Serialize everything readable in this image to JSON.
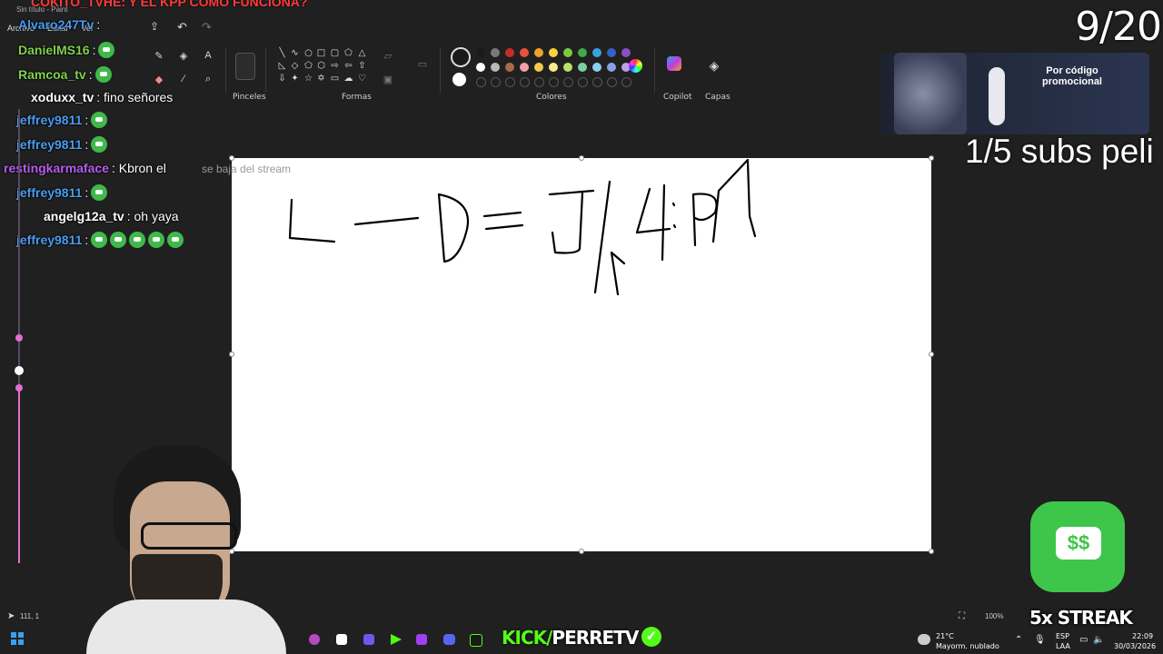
{
  "window": {
    "title": "Sin título - Paint",
    "menu": [
      "Archivo",
      "Editar",
      "Ver"
    ]
  },
  "ribbon": {
    "groups": {
      "brushes": "Pinceles",
      "shapes": "Formas",
      "colors": "Colores",
      "copilot": "Copilot",
      "layers": "Capas"
    },
    "colors_row1": [
      "#1a1a1a",
      "#7a7a7a",
      "#c42b2b",
      "#e5533b",
      "#f0a030",
      "#f6d53a",
      "#7ec83e",
      "#3ea84a",
      "#3aa0e0",
      "#3561c8",
      "#8d4fc0"
    ],
    "colors_row2": [
      "#ffffff",
      "#b8b8b8",
      "#a86a4a",
      "#f0a0a8",
      "#f6c84a",
      "#f6ec8a",
      "#b8e06a",
      "#7ad0a0",
      "#8ad0f0",
      "#8aa0e0",
      "#c0a0e0"
    ],
    "primary_color": "#1a1a1a",
    "secondary_color": "#ffffff"
  },
  "chat": {
    "top_message": "COKITO_TVHE: Y EL KPP COMO FUNCIONA?",
    "lines": [
      {
        "user": "Alvaro247Tv",
        "color": "#4a9cf0",
        "text": ":"
      },
      {
        "user": "DanielMS16",
        "color": "#7ed24a",
        "text": ":"
      },
      {
        "user": "Ramcoa_tv",
        "color": "#7ed24a",
        "text": ":"
      },
      {
        "user": "xoduxx_tv",
        "color": "#ffffff",
        "text": ": fino señores"
      },
      {
        "user": "jeffrey9811",
        "color": "#4a9cf0",
        "text": ":"
      },
      {
        "user": "jeffrey9811",
        "color": "#4a9cf0",
        "text": ":"
      },
      {
        "user": "restingkarmaface",
        "color": "#b85cf0",
        "text": ": Kbron el"
      },
      {
        "user": "jeffrey9811",
        "color": "#4a9cf0",
        "text": ":"
      },
      {
        "user": "angelg12a_tv",
        "color": "#ffffff",
        "text": ": oh yaya"
      },
      {
        "user": "jeffrey9811",
        "color": "#4a9cf0",
        "text": ":"
      }
    ],
    "stream_note": "se baja del stream"
  },
  "overlay": {
    "counter": "9/20",
    "subs_goal": "1/5 subs peli",
    "promo": "Por código promocional",
    "streak": "5x STREAK",
    "kick_prefix": "KICK/",
    "kick_name": "PERRETV",
    "kick_check": "✓"
  },
  "status": {
    "coords": "111, 1",
    "zoom": "100%"
  },
  "taskbar": {
    "weather_temp": "21°C",
    "weather_desc": "Mayorm. nublado",
    "lang": "ESP",
    "lang2": "LAA",
    "time": "22:09",
    "date": "30/03/2026"
  },
  "drawing": {
    "glyphs": [
      "L",
      "—",
      "D",
      "=",
      "J",
      "4",
      ":",
      "P"
    ]
  }
}
